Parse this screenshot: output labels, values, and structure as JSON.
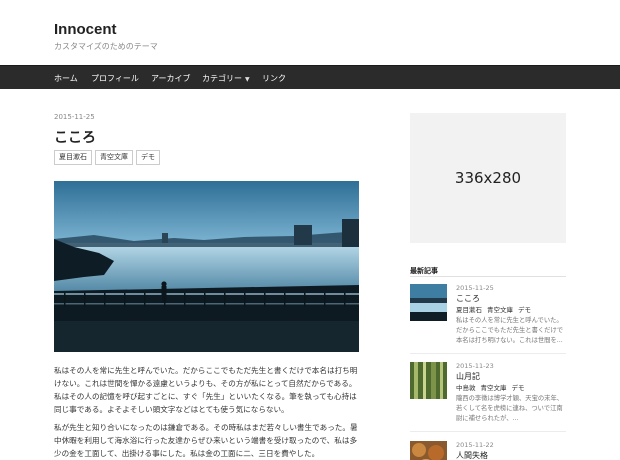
{
  "site": {
    "title": "Innocent",
    "description": "カスタマイズのためのテーマ"
  },
  "nav": {
    "items": [
      "ホーム",
      "プロフィール",
      "アーカイブ",
      "カテゴリー",
      "リンク"
    ],
    "dropdown_icon": "chevron-down-icon"
  },
  "post": {
    "date": "2015-11-25",
    "title": "こころ",
    "tags": [
      "夏目漱石",
      "青空文庫",
      "デモ"
    ],
    "paragraphs": [
      "私はその人を常に先生と呼んでいた。だからここでもただ先生と書くだけで本名は打ち明けない。これは世間を憚かる遠慮というよりも、その方が私にとって自然だからである。私はその人の記憶を呼び起すごとに、すぐ「先生」といいたくなる。筆を執っても心持は同じ事である。よそよそしい頭文字などはとても使う気にならない。",
      "私が先生と知り合いになったのは鎌倉である。その時私はまだ若々しい書生であった。暑中休暇を利用して海水浴に行った友達からぜひ来いという端書を受け取ったので、私は多少の金を工面して、出掛ける事にした。私は金の工面に二、三日を費やした。"
    ]
  },
  "sidebar": {
    "ad_label": "336x280",
    "recent_heading": "最新記事",
    "recent": [
      {
        "date": "2015-11-25",
        "title": "こころ",
        "tags": [
          "夏目漱石",
          "青空文庫",
          "デモ"
        ],
        "excerpt": "私はその人を常に先生と呼んでいた。だからここでもただ先生と書くだけで本名は打ち明けない。これは世間を..."
      },
      {
        "date": "2015-11-23",
        "title": "山月記",
        "tags": [
          "中島敦",
          "青空文庫",
          "デモ"
        ],
        "excerpt": "隴西の李徴は博学才穎、天宝の末年、若くして名を虎榜に連ね、ついで江南尉に補せられたが、..."
      },
      {
        "date": "2015-11-22",
        "title": "人間失格",
        "tags": [],
        "excerpt": ""
      }
    ]
  },
  "colors": {
    "nav_bg": "#2b2b2b",
    "ad_bg": "#f2f2f2"
  }
}
